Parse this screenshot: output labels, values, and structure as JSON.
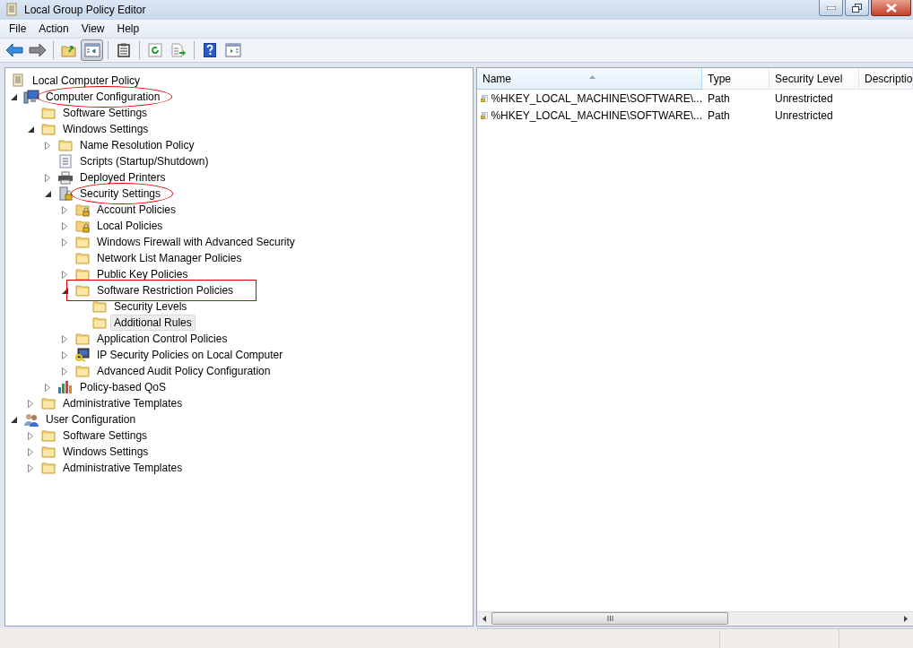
{
  "window": {
    "title": "Local Group Policy Editor"
  },
  "menu": [
    "File",
    "Action",
    "View",
    "Help"
  ],
  "toolbar": [
    [
      {
        "kind": "back",
        "disabled": false,
        "pressed": false
      },
      {
        "kind": "forward",
        "disabled": true,
        "pressed": false
      }
    ],
    [
      {
        "kind": "up",
        "disabled": false,
        "pressed": false
      },
      {
        "kind": "console-tree",
        "disabled": false,
        "pressed": true
      }
    ],
    [
      {
        "kind": "properties",
        "disabled": false,
        "pressed": false
      }
    ],
    [
      {
        "kind": "refresh",
        "disabled": false,
        "pressed": false
      },
      {
        "kind": "export",
        "disabled": false,
        "pressed": false
      }
    ],
    [
      {
        "kind": "help",
        "disabled": false,
        "pressed": false
      },
      {
        "kind": "action-pane",
        "disabled": false,
        "pressed": false
      }
    ]
  ],
  "tree": [
    {
      "label": "Local Computer Policy",
      "kind": "scroll",
      "expandable": false,
      "selected": false,
      "circled": false,
      "boxed": false,
      "children": [
        {
          "label": "Computer Configuration",
          "kind": "computer",
          "expandable": true,
          "expanded": true,
          "selected": false,
          "circled": true,
          "boxed": false,
          "children": [
            {
              "label": "Software Settings",
              "kind": "folder",
              "expandable": false,
              "selected": false,
              "circled": false,
              "boxed": false
            },
            {
              "label": "Windows Settings",
              "kind": "folder",
              "expandable": true,
              "expanded": true,
              "selected": false,
              "circled": false,
              "boxed": false,
              "children": [
                {
                  "label": "Name Resolution Policy",
                  "kind": "folder",
                  "expandable": true,
                  "expanded": false,
                  "selected": false,
                  "circled": false,
                  "boxed": false
                },
                {
                  "label": "Scripts (Startup/Shutdown)",
                  "kind": "script",
                  "expandable": false,
                  "selected": false,
                  "circled": false,
                  "boxed": false
                },
                {
                  "label": "Deployed Printers",
                  "kind": "printer",
                  "expandable": true,
                  "expanded": false,
                  "selected": false,
                  "circled": false,
                  "boxed": false
                },
                {
                  "label": "Security Settings",
                  "kind": "security",
                  "expandable": true,
                  "expanded": true,
                  "selected": false,
                  "circled": true,
                  "boxed": false,
                  "children": [
                    {
                      "label": "Account Policies",
                      "kind": "folder-lock",
                      "expandable": true,
                      "expanded": false,
                      "selected": false,
                      "circled": false,
                      "boxed": false
                    },
                    {
                      "label": "Local Policies",
                      "kind": "folder-lock",
                      "expandable": true,
                      "expanded": false,
                      "selected": false,
                      "circled": false,
                      "boxed": false
                    },
                    {
                      "label": "Windows Firewall with Advanced Security",
                      "kind": "folder",
                      "expandable": true,
                      "expanded": false,
                      "selected": false,
                      "circled": false,
                      "boxed": false
                    },
                    {
                      "label": "Network List Manager Policies",
                      "kind": "folder",
                      "expandable": false,
                      "selected": false,
                      "circled": false,
                      "boxed": false
                    },
                    {
                      "label": "Public Key Policies",
                      "kind": "folder",
                      "expandable": true,
                      "expanded": false,
                      "selected": false,
                      "circled": false,
                      "boxed": false
                    },
                    {
                      "label": "Software Restriction Policies",
                      "kind": "folder",
                      "expandable": true,
                      "expanded": true,
                      "selected": false,
                      "circled": false,
                      "boxed": true,
                      "children": [
                        {
                          "label": "Security Levels",
                          "kind": "folder",
                          "expandable": false,
                          "selected": false,
                          "circled": false,
                          "boxed": false
                        },
                        {
                          "label": "Additional Rules",
                          "kind": "folder",
                          "expandable": false,
                          "selected": true,
                          "circled": false,
                          "boxed": false
                        }
                      ]
                    },
                    {
                      "label": "Application Control Policies",
                      "kind": "folder",
                      "expandable": true,
                      "expanded": false,
                      "selected": false,
                      "circled": false,
                      "boxed": false
                    },
                    {
                      "label": "IP Security Policies on Local Computer",
                      "kind": "ip-security",
                      "expandable": true,
                      "expanded": false,
                      "selected": false,
                      "circled": false,
                      "boxed": false
                    },
                    {
                      "label": "Advanced Audit Policy Configuration",
                      "kind": "folder",
                      "expandable": true,
                      "expanded": false,
                      "selected": false,
                      "circled": false,
                      "boxed": false
                    }
                  ]
                },
                {
                  "label": "Policy-based QoS",
                  "kind": "chart",
                  "expandable": true,
                  "expanded": false,
                  "selected": false,
                  "circled": false,
                  "boxed": false
                }
              ]
            },
            {
              "label": "Administrative Templates",
              "kind": "folder",
              "expandable": true,
              "expanded": false,
              "selected": false,
              "circled": false,
              "boxed": false
            }
          ]
        },
        {
          "label": "User Configuration",
          "kind": "user",
          "expandable": true,
          "expanded": true,
          "selected": false,
          "circled": false,
          "boxed": false,
          "children": [
            {
              "label": "Software Settings",
              "kind": "folder",
              "expandable": true,
              "expanded": false,
              "selected": false,
              "circled": false,
              "boxed": false
            },
            {
              "label": "Windows Settings",
              "kind": "folder",
              "expandable": true,
              "expanded": false,
              "selected": false,
              "circled": false,
              "boxed": false
            },
            {
              "label": "Administrative Templates",
              "kind": "folder",
              "expandable": true,
              "expanded": false,
              "selected": false,
              "circled": false,
              "boxed": false
            }
          ]
        }
      ]
    }
  ],
  "list": {
    "columns": [
      {
        "label": "Name",
        "sorted": true
      },
      {
        "label": "Type",
        "sorted": false
      },
      {
        "label": "Security Level",
        "sorted": false
      },
      {
        "label": "Descriptio",
        "sorted": false
      }
    ],
    "rows": [
      {
        "name": "%HKEY_LOCAL_MACHINE\\SOFTWARE\\...",
        "type": "Path",
        "security_level": "Unrestricted"
      },
      {
        "name": "%HKEY_LOCAL_MACHINE\\SOFTWARE\\...",
        "type": "Path",
        "security_level": "Unrestricted"
      }
    ]
  }
}
